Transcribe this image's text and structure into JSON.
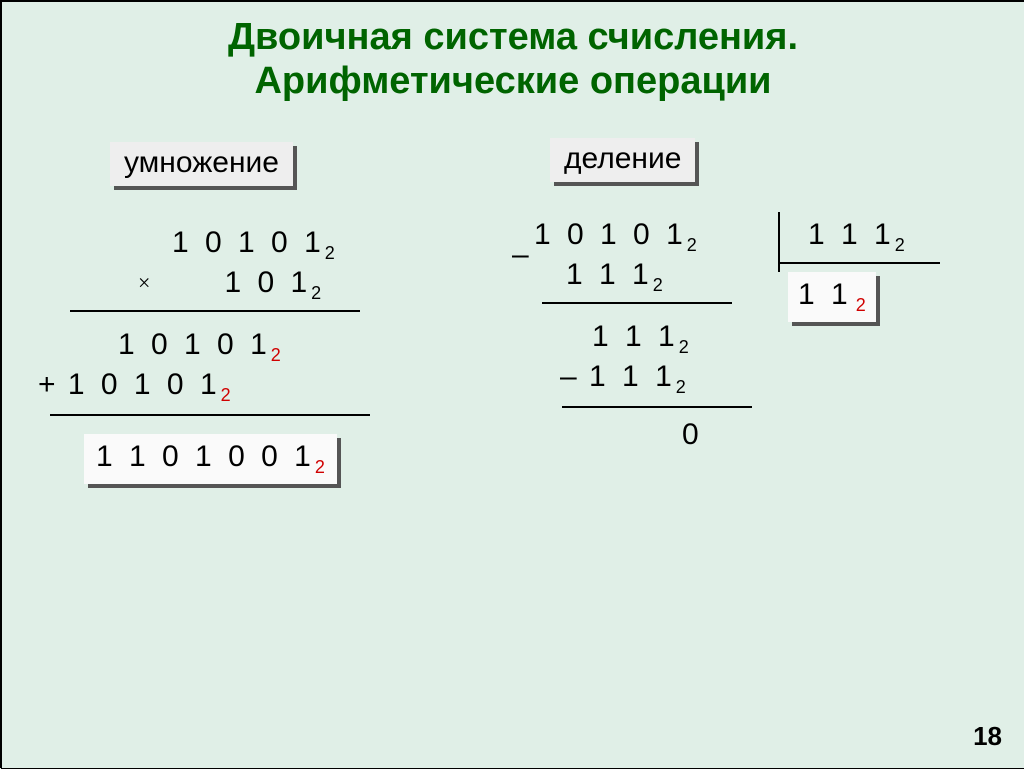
{
  "title_line1": "Двоичная система счисления.",
  "title_line2": "Арифметические операции",
  "labels": {
    "mul": "умножение",
    "div": "деление"
  },
  "symbols": {
    "times": "×",
    "plus": "+",
    "minus": "–"
  },
  "subscript": {
    "black": "2",
    "red": "2"
  },
  "mult": {
    "a": "1 0 1 0 1",
    "b": "1 0 1",
    "p1": "1 0 1 0 1",
    "p2": "1 0 1 0 1",
    "result": "1 1 0 1 0 0 1"
  },
  "div": {
    "dividend": "1 0 1 0 1",
    "step1_sub": "1 1 1",
    "r1": "1 1 1",
    "step2_sub": "1 1 1",
    "r2": "0",
    "divisor": "1 1 1",
    "quotient": "1  1"
  },
  "page": "18"
}
